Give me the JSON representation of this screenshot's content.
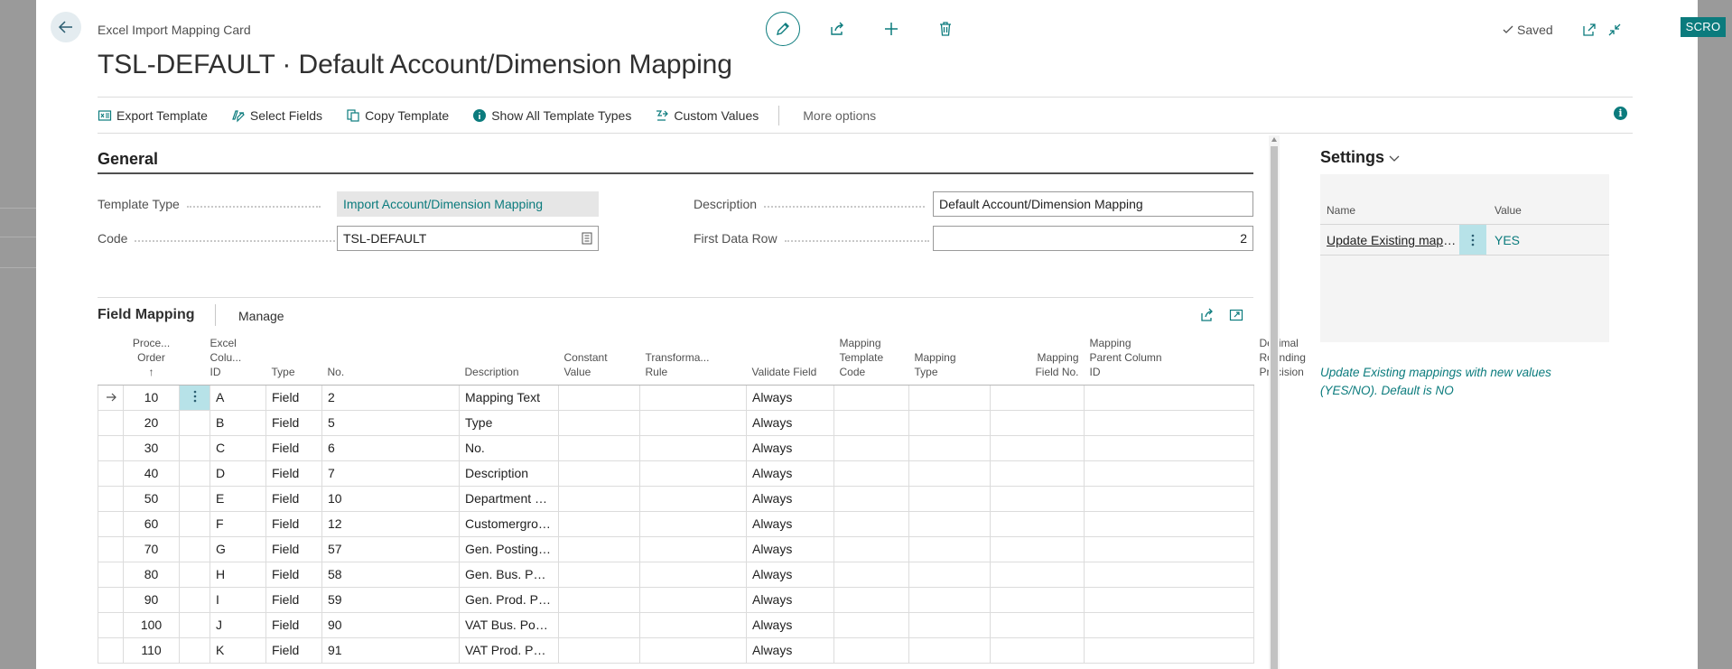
{
  "environment_badge": "SCRO",
  "header": {
    "caption": "Excel Import Mapping Card",
    "title": "TSL-DEFAULT · Default Account/Dimension Mapping",
    "status": "Saved",
    "icons": [
      "back-arrow-icon",
      "pencil-edit-icon",
      "share-icon",
      "plus-icon",
      "trash-icon",
      "check-icon",
      "open-new-window-icon",
      "collapse-icon"
    ]
  },
  "actionbar": {
    "items": [
      {
        "label": "Export Template",
        "icon": "excel-export-icon"
      },
      {
        "label": "Select Fields",
        "icon": "select-fields-icon"
      },
      {
        "label": "Copy Template",
        "icon": "copy-icon"
      },
      {
        "label": "Show All Template Types",
        "icon": "info-icon"
      },
      {
        "label": "Custom Values",
        "icon": "custom-values-icon"
      }
    ],
    "more": "More options"
  },
  "general": {
    "title": "General",
    "fields": {
      "template_type": {
        "label": "Template Type",
        "value": "Import Account/Dimension Mapping"
      },
      "code": {
        "label": "Code",
        "value": "TSL-DEFAULT"
      },
      "description": {
        "label": "Description",
        "value": "Default Account/Dimension Mapping"
      },
      "first_data_row": {
        "label": "First Data Row",
        "value": "2"
      }
    }
  },
  "field_mapping": {
    "title": "Field Mapping",
    "manage": "Manage",
    "columns": {
      "order_l1": "Proce...",
      "order_l2": "Order",
      "order_l3": "↑",
      "excel_l1": "Excel",
      "excel_l2": "Colu...",
      "excel_l3": "ID",
      "type": "Type",
      "no": "No.",
      "description": "Description",
      "constant": "Constant Value",
      "transform_l1": "Transforma...",
      "transform_l2": "Rule",
      "validate": "Validate Field",
      "map_tpl_l1": "Mapping",
      "map_tpl_l2": "Template",
      "map_tpl_l3": "Code",
      "map_type_l1": "Mapping",
      "map_type_l2": "Type",
      "map_field_l1": "Mapping",
      "map_field_l2": "Field No.",
      "map_parent_l1": "Mapping",
      "map_parent_l2": "Parent Column",
      "map_parent_l3": "ID",
      "decimal_l1": "Decimal Rounding",
      "decimal_l2": "Precision"
    },
    "rows": [
      {
        "order": "10",
        "col": "A",
        "type": "Field",
        "no": "2",
        "description": "Mapping Text",
        "validate": "Always"
      },
      {
        "order": "20",
        "col": "B",
        "type": "Field",
        "no": "5",
        "description": "Type",
        "validate": "Always"
      },
      {
        "order": "30",
        "col": "C",
        "type": "Field",
        "no": "6",
        "description": "No.",
        "validate": "Always"
      },
      {
        "order": "40",
        "col": "D",
        "type": "Field",
        "no": "7",
        "description": "Description",
        "validate": "Always"
      },
      {
        "order": "50",
        "col": "E",
        "type": "Field",
        "no": "10",
        "description": "Department Code",
        "validate": "Always"
      },
      {
        "order": "60",
        "col": "F",
        "type": "Field",
        "no": "12",
        "description": "Customergroup Code",
        "validate": "Always"
      },
      {
        "order": "70",
        "col": "G",
        "type": "Field",
        "no": "57",
        "description": "Gen. Posting Type",
        "validate": "Always"
      },
      {
        "order": "80",
        "col": "H",
        "type": "Field",
        "no": "58",
        "description": "Gen. Bus. Posting Gr...",
        "validate": "Always"
      },
      {
        "order": "90",
        "col": "I",
        "type": "Field",
        "no": "59",
        "description": "Gen. Prod. Posting Gr...",
        "validate": "Always"
      },
      {
        "order": "100",
        "col": "J",
        "type": "Field",
        "no": "90",
        "description": "VAT Bus. Posting Gro...",
        "validate": "Always"
      },
      {
        "order": "110",
        "col": "K",
        "type": "Field",
        "no": "91",
        "description": "VAT Prod. Posting Gr...",
        "validate": "Always"
      }
    ]
  },
  "settings": {
    "title": "Settings",
    "name_header": "Name",
    "value_header": "Value",
    "row_name": "Update Existing mappings",
    "row_value": "YES",
    "help": "Update Existing mappings with new values (YES/NO).  Default is NO"
  },
  "colors": {
    "accent": "#0b7b7d",
    "highlight": "#b7e2e8",
    "readonly_bg": "#e6e6e6"
  }
}
